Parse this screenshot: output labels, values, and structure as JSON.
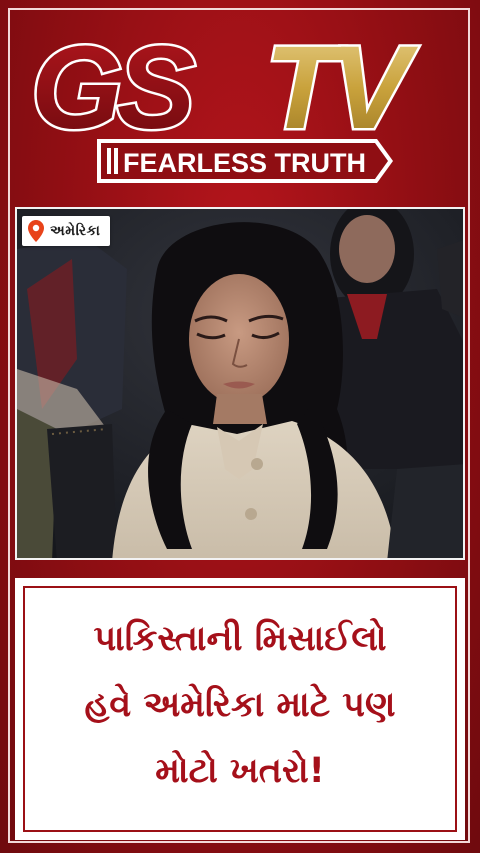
{
  "logo": {
    "brand_left": "GS",
    "brand_right": "TV",
    "tagline": "FEARLESS TRUTH"
  },
  "location": {
    "label": "અમેરિકા",
    "icon": "location-pin-icon"
  },
  "headline": {
    "lines": [
      "પાકિસ્તાની મિસાઈલો",
      "હવે અમેરિકા માટે પણ",
      "મોટો ખતરો!"
    ]
  },
  "colors": {
    "background": "#8f0e13",
    "headline": "#a5101a",
    "gold": "#c9a23c",
    "red_logo": "#8a0d12"
  }
}
